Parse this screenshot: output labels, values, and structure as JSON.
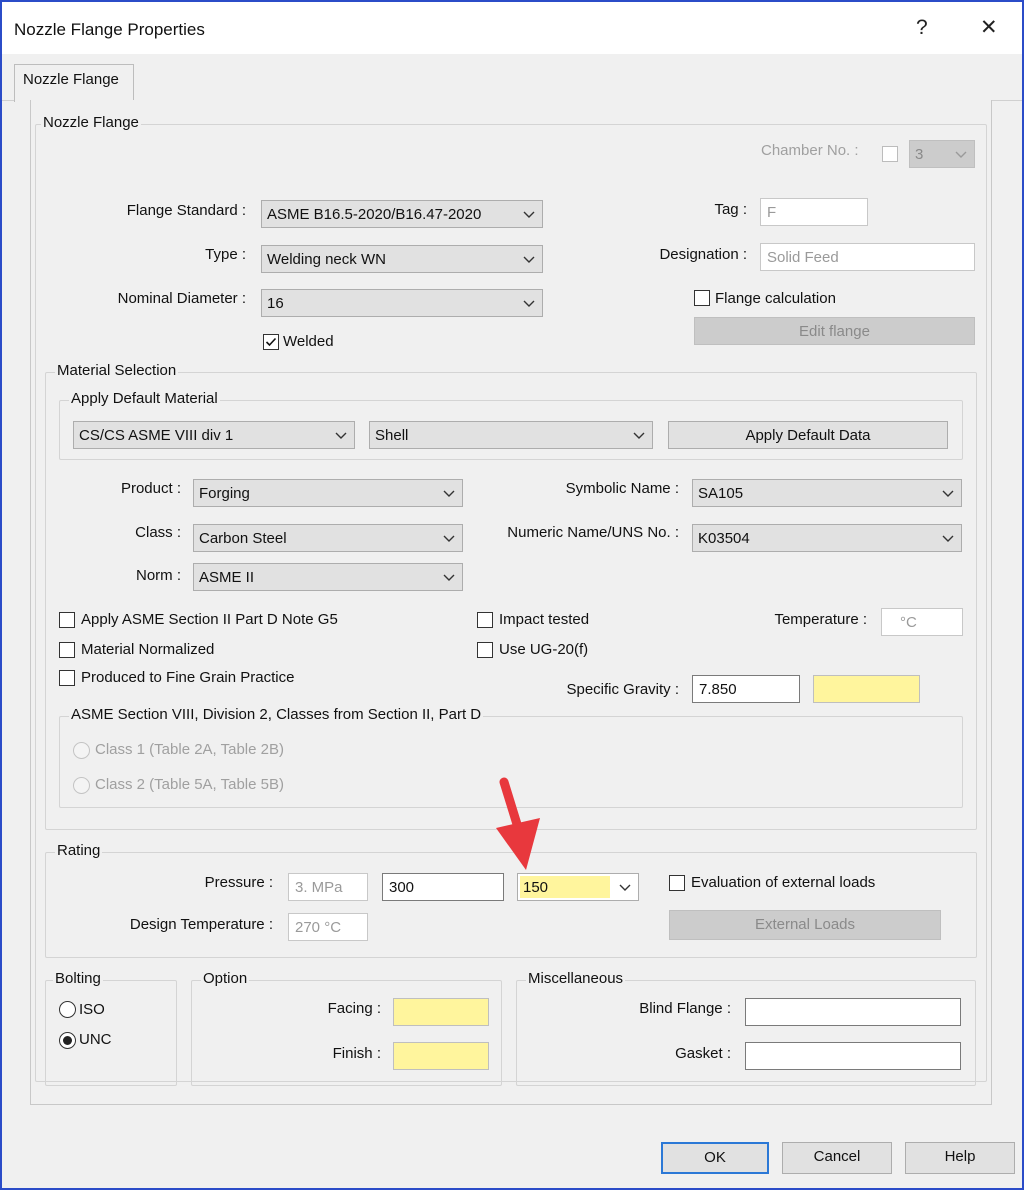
{
  "window": {
    "title": "Nozzle Flange Properties",
    "help_glyph": "?",
    "close_glyph": "✕"
  },
  "tab": {
    "label": "Nozzle Flange"
  },
  "nozzle_flange": {
    "group_title": "Nozzle Flange",
    "chamber_label": "Chamber No. :",
    "chamber_value": "3",
    "chamber_checked": false,
    "flange_standard_label": "Flange Standard :",
    "flange_standard_value": "ASME B16.5-2020/B16.47-2020",
    "type_label": "Type :",
    "type_value": "Welding neck WN",
    "nominal_diameter_label": "Nominal Diameter :",
    "nominal_diameter_value": "16",
    "welded_label": "Welded",
    "welded_checked": true,
    "tag_label": "Tag :",
    "tag_value": "F",
    "designation_label": "Designation :",
    "designation_value": "Solid Feed",
    "flange_calc_label": "Flange calculation",
    "flange_calc_checked": false,
    "edit_flange_label": "Edit flange"
  },
  "material": {
    "group_title": "Material Selection",
    "default_group_title": "Apply Default Material",
    "default_material_value": "CS/CS ASME VIII div 1",
    "default_part_value": "Shell",
    "apply_default_label": "Apply Default Data",
    "product_label": "Product :",
    "product_value": "Forging",
    "class_label": "Class :",
    "class_value": "Carbon Steel",
    "norm_label": "Norm :",
    "norm_value": "ASME II",
    "symbolic_label": "Symbolic Name :",
    "symbolic_value": "SA105",
    "numeric_label": "Numeric Name/UNS No. :",
    "numeric_value": "K03504",
    "note_g5_label": "Apply ASME Section II Part D Note G5",
    "normalized_label": "Material Normalized",
    "fine_grain_label": "Produced to Fine Grain Practice",
    "impact_label": "Impact tested",
    "ug20_label": "Use UG-20(f)",
    "temperature_label": "Temperature :",
    "temperature_value": "°C",
    "sg_label": "Specific Gravity :",
    "sg_value": "7.850",
    "div2_group_title": "ASME Section VIII, Division 2, Classes from Section II, Part D",
    "class1_label": "Class 1 (Table 2A, Table 2B)",
    "class2_label": "Class 2 (Table 5A, Table 5B)"
  },
  "rating": {
    "group_title": "Rating",
    "pressure_label": "Pressure :",
    "pressure_value": "3. MPa",
    "pressure_input": "300",
    "class_value": "150",
    "design_temp_label": "Design Temperature :",
    "design_temp_value": "270 °C",
    "ext_loads_check_label": "Evaluation of external loads",
    "ext_loads_checked": false,
    "ext_loads_button": "External Loads"
  },
  "bolting": {
    "group_title": "Bolting",
    "iso_label": "ISO",
    "unc_label": "UNC",
    "selected": "UNC"
  },
  "option": {
    "group_title": "Option",
    "facing_label": "Facing :",
    "finish_label": "Finish :"
  },
  "misc": {
    "group_title": "Miscellaneous",
    "blind_label": "Blind Flange :",
    "gasket_label": "Gasket :"
  },
  "buttons": {
    "ok": "OK",
    "cancel": "Cancel",
    "help": "Help"
  },
  "colors": {
    "highlight_yellow": "#fff59d",
    "annotation_arrow": "#e8383d",
    "window_border": "#2b4cc8"
  }
}
